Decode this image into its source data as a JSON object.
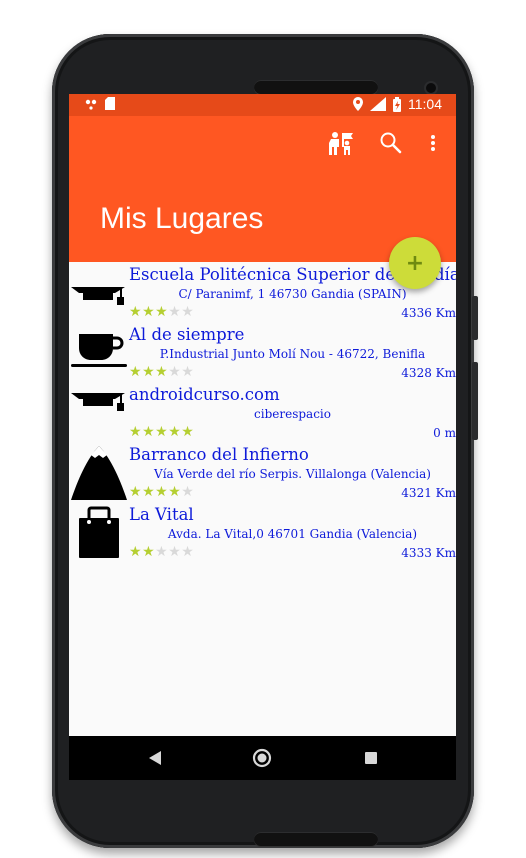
{
  "status_bar": {
    "time": "11:04"
  },
  "app_bar": {
    "title": "Mis Lugares",
    "actions": [
      "people-icon",
      "search-icon",
      "more-vert-icon"
    ]
  },
  "fab": {
    "label": "+"
  },
  "places": [
    {
      "name": "Escuela Politécnica Superior de Gandía",
      "address": "C/ Paranimf, 1 46730 Gandia (SPAIN)",
      "rating": 3,
      "distance": "4336 Km",
      "icon": "graduation-cap-icon"
    },
    {
      "name": "Al de siempre",
      "address": "P.Industrial Junto Molí Nou - 46722, Benifla",
      "rating": 3,
      "distance": "4328 Km",
      "icon": "coffee-cup-icon"
    },
    {
      "name": "androidcurso.com",
      "address": "ciberespacio",
      "rating": 5,
      "distance": "0 m",
      "icon": "graduation-cap-icon"
    },
    {
      "name": "Barranco del Infierno",
      "address": "Vía Verde del río Serpis. Villalonga (Valencia)",
      "rating": 4,
      "distance": "4321 Km",
      "icon": "mountain-icon"
    },
    {
      "name": "La Vital",
      "address": "Avda. La Vital,0 46701 Gandia (Valencia)",
      "rating": 2,
      "distance": "4333 Km",
      "icon": "shopping-bag-icon"
    }
  ],
  "colors": {
    "primary": "#ff5722",
    "primary_dark": "#e64a19",
    "accent": "#cddc39",
    "text_link": "#0d1ad9"
  }
}
